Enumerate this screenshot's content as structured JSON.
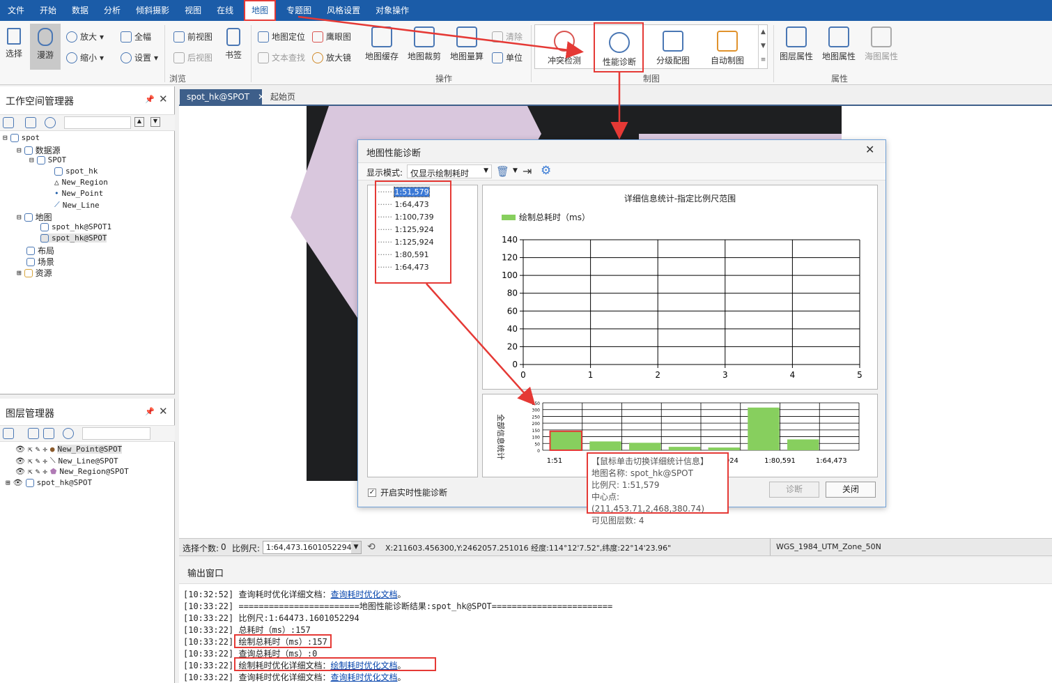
{
  "menu": {
    "items": [
      "文件",
      "开始",
      "数据",
      "分析",
      "倾斜摄影",
      "视图",
      "在线",
      "地图",
      "专题图",
      "风格设置",
      "对象操作"
    ]
  },
  "ribbon": {
    "select": "选择",
    "pan": "漫游",
    "zoom_in": "放大",
    "zoom_out": "缩小",
    "full": "全幅",
    "settings": "设置",
    "prev_view": "前视图",
    "next_view": "后视图",
    "bookmark": "书签",
    "locate": "地图定位",
    "text_find": "文本查找",
    "eagle": "鹰眼图",
    "magnifier": "放大镜",
    "cache": "地图缓存",
    "clip": "地图裁剪",
    "measure": "地图量算",
    "clear": "清除",
    "unit": "单位",
    "conflict": "冲突检测",
    "perf": "性能诊断",
    "grade": "分级配图",
    "auto": "自动制图",
    "layer_prop": "图层属性",
    "map_prop": "地图属性",
    "ocean_prop": "海图属性",
    "group_browse": "浏览",
    "group_ops": "操作",
    "group_mapping": "制图",
    "group_props": "属性"
  },
  "workspace": {
    "title": "工作空间管理器",
    "nodes": [
      "spot",
      "数据源",
      "SPOT",
      "spot_hk",
      "New_Region",
      "New_Point",
      "New_Line",
      "地图",
      "spot_hk@SPOT1",
      "spot_hk@SPOT",
      "布局",
      "场景",
      "资源"
    ]
  },
  "layers": {
    "title": "图层管理器",
    "items": [
      "New_Point@SPOT",
      "New_Line@SPOT",
      "New_Region@SPOT",
      "spot_hk@SPOT"
    ]
  },
  "tabs": [
    "spot_hk@SPOT",
    "起始页"
  ],
  "dialog": {
    "title": "地图性能诊断",
    "mode_label": "显示模式:",
    "mode_value": "仅显示绘制耗时",
    "scales": [
      "1:51,579",
      "1:64,473",
      "1:100,739",
      "1:125,924",
      "1:125,924",
      "1:80,591",
      "1:64,473"
    ],
    "chart_title": "详细信息统计-指定比例尺范围",
    "legend": "绘制总耗时（ms）",
    "y_ticks": [
      "140",
      "120",
      "100",
      "80",
      "60",
      "40",
      "20",
      "0"
    ],
    "x_ticks": [
      "0",
      "1",
      "2",
      "3",
      "4",
      "5"
    ],
    "overview_ylabel": "全部信息统计",
    "overview_y_ticks": [
      "350",
      "300",
      "250",
      "200",
      "150",
      "100",
      "50",
      "0"
    ],
    "overview_x_labels": [
      "1:51",
      "1:125,924",
      "1:80,591",
      "1:64,473"
    ],
    "tooltip": [
      "【鼠标单击切换详细统计信息】",
      "地图名称: spot_hk@SPOT",
      "比例尺: 1:51,579",
      "中心点: (211,453.71,2,468,380.74)",
      "可见图层数: 4"
    ],
    "realtime": "开启实时性能诊断",
    "diagnose": "诊断",
    "close": "关闭"
  },
  "chart_data": [
    {
      "type": "bar",
      "title": "详细信息统计-指定比例尺范围",
      "series": [
        {
          "name": "绘制总耗时（ms）",
          "values": []
        }
      ],
      "ylim": [
        0,
        140
      ],
      "xlim": [
        0,
        5
      ]
    },
    {
      "type": "bar",
      "ylabel": "全部信息统计",
      "categories": [
        "1:51,579",
        "1:64,473",
        "1:100,739",
        "1:125,924",
        "1:125,924",
        "1:80,591",
        "1:64,473"
      ],
      "values": [
        140,
        65,
        55,
        25,
        20,
        315,
        80
      ],
      "ylim": [
        0,
        350
      ]
    }
  ],
  "status": {
    "sel_label": "选择个数:",
    "sel_value": "0",
    "scale_label": "比例尺:",
    "scale_value": "1:64,473.1601052294",
    "coords": "X:211603.456300,Y:2462057.251016  经度:114°12'7.52\",纬度:22°14'23.96\"",
    "crs": "WGS_1984_UTM_Zone_50N"
  },
  "output": {
    "title": "输出窗口",
    "lines": [
      {
        "t": "[10:32:52] 查询耗时优化详细文档：",
        "link": "查询耗时优化文档",
        "tail": "。"
      },
      {
        "t": "[10:33:22] ========================地图性能诊断结果:spot_hk@SPOT========================",
        "link": "",
        "tail": ""
      },
      {
        "t": "[10:33:22] 比例尺:1:64473.1601052294",
        "link": "",
        "tail": ""
      },
      {
        "t": "[10:33:22] 总耗时（ms）:157",
        "link": "",
        "tail": ""
      },
      {
        "t": "[10:33:22] 绘制总耗时（ms）:157",
        "link": "",
        "tail": ""
      },
      {
        "t": "[10:33:22] 查询总耗时（ms）:0",
        "link": "",
        "tail": ""
      },
      {
        "t": "[10:33:22] 绘制耗时优化详细文档：",
        "link": "绘制耗时优化文档",
        "tail": "。"
      },
      {
        "t": "[10:33:22] 查询耗时优化详细文档：",
        "link": "查询耗时优化文档",
        "tail": "。"
      }
    ]
  }
}
